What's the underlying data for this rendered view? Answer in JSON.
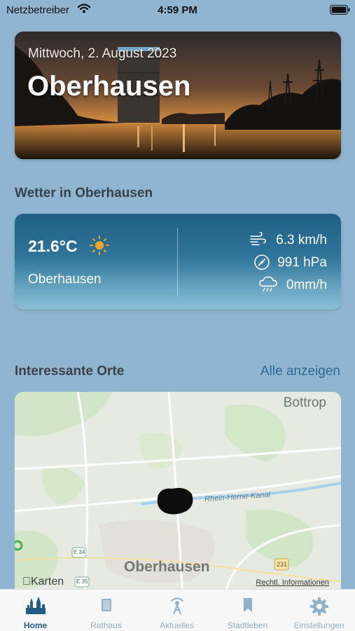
{
  "status_bar": {
    "carrier": "Netzbetreiber",
    "time": "4:59 PM"
  },
  "hero": {
    "date": "Mittwoch, 2. August 2023",
    "city": "Oberhausen"
  },
  "weather": {
    "section_title": "Wetter in Oberhausen",
    "temperature": "21.6°C",
    "city": "Oberhausen",
    "wind": "6.3 km/h",
    "pressure": "991 hPa",
    "rain": "0mm/h"
  },
  "places": {
    "section_title": "Interessante Orte",
    "see_all": "Alle anzeigen",
    "map": {
      "label_bottrop": "Bottrop",
      "label_oberhausen": "Oberhausen",
      "label_canal": "Rhein-Herne-Kanal",
      "attribution": "Karten",
      "legal": "Rechtl. Informationen",
      "road_e34": "E 34",
      "road_e35": "E 35",
      "road_231": "231"
    }
  },
  "tabs": [
    {
      "label": "Home",
      "icon": "home-cathedral-icon",
      "active": true
    },
    {
      "label": "Rathaus",
      "icon": "book-icon",
      "active": false
    },
    {
      "label": "Aktuelles",
      "icon": "antenna-icon",
      "active": false
    },
    {
      "label": "Stadtleben",
      "icon": "bookmark-icon",
      "active": false
    },
    {
      "label": "Einstellungen",
      "icon": "gear-icon",
      "active": false
    }
  ],
  "colors": {
    "background": "#8fb5d1",
    "accent": "#1f5c88",
    "tab_inactive": "#8fb1c7"
  }
}
